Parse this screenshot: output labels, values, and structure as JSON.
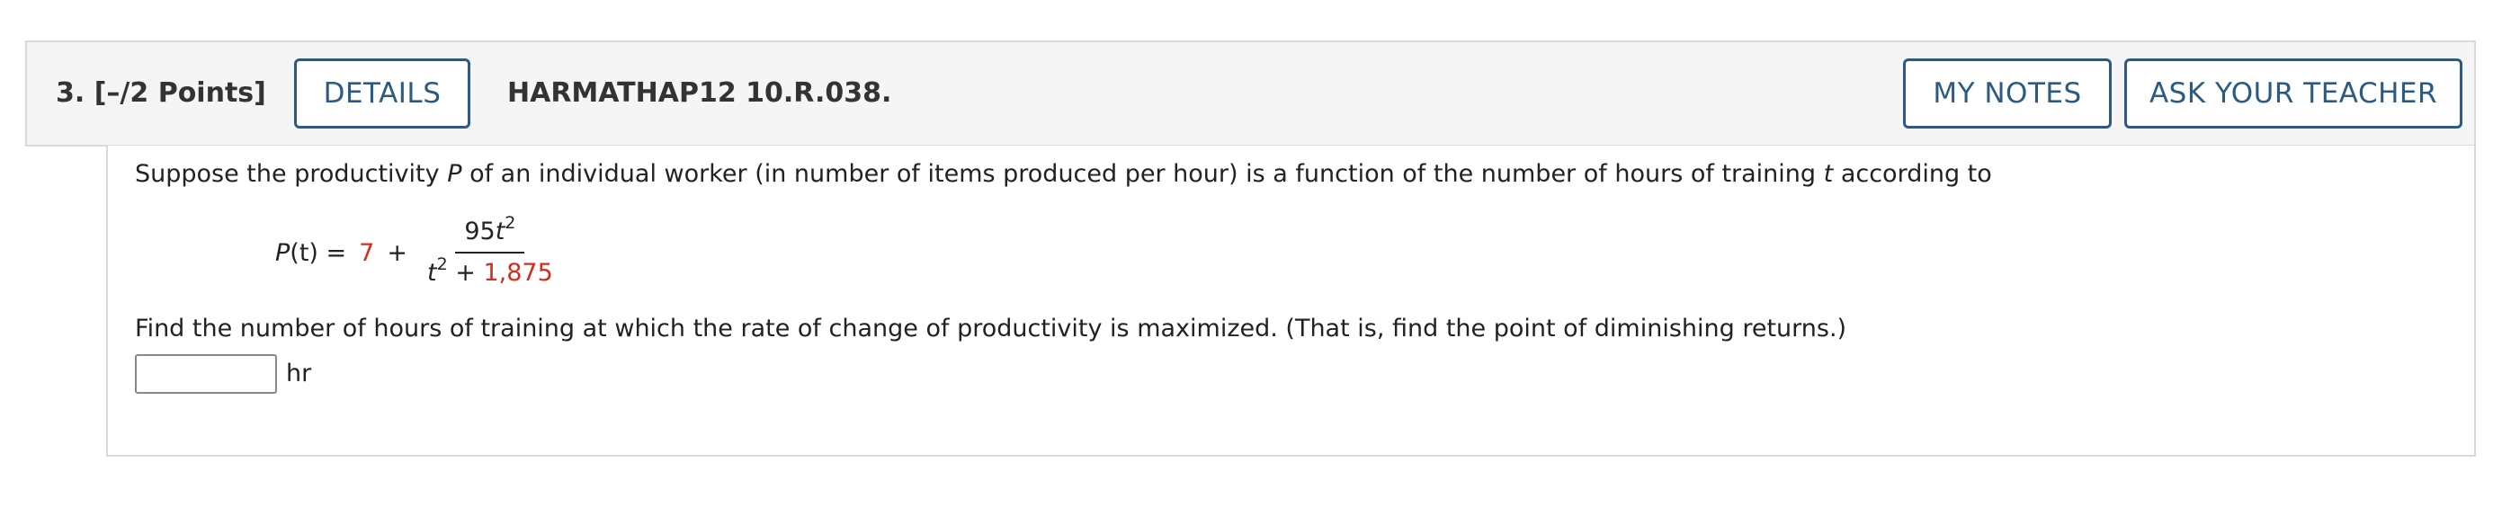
{
  "header": {
    "question_number": "3.  [–/2 Points]",
    "details_label": "DETAILS",
    "question_id": "HARMATHAP12 10.R.038.",
    "my_notes_label": "MY NOTES",
    "ask_teacher_label": "ASK YOUR TEACHER"
  },
  "problem": {
    "intro_part1": "Suppose the productivity ",
    "intro_var_p": "P",
    "intro_part2": " of an individual worker (in number of items produced per hour) is a function of the number of hours of training ",
    "intro_var_t": "t",
    "intro_part3": " according to",
    "formula": {
      "lhs_func": "P",
      "lhs_arg": "(t) =",
      "constant": "7",
      "plus": "+",
      "numerator_coef": "95",
      "numerator_var": "t",
      "numerator_exp": "2",
      "denominator_var": "t",
      "denominator_exp": "2",
      "denominator_plus": " + ",
      "denominator_constant": "1,875"
    },
    "question": "Find the number of hours of training at which the rate of change of productivity is maximized. (That is, find the point of diminishing returns.)",
    "answer_value": "",
    "answer_unit": "hr"
  },
  "colors": {
    "button_border": "#2b5b84",
    "highlight_red": "#d62b1f",
    "header_bg": "#f5f5f5"
  }
}
